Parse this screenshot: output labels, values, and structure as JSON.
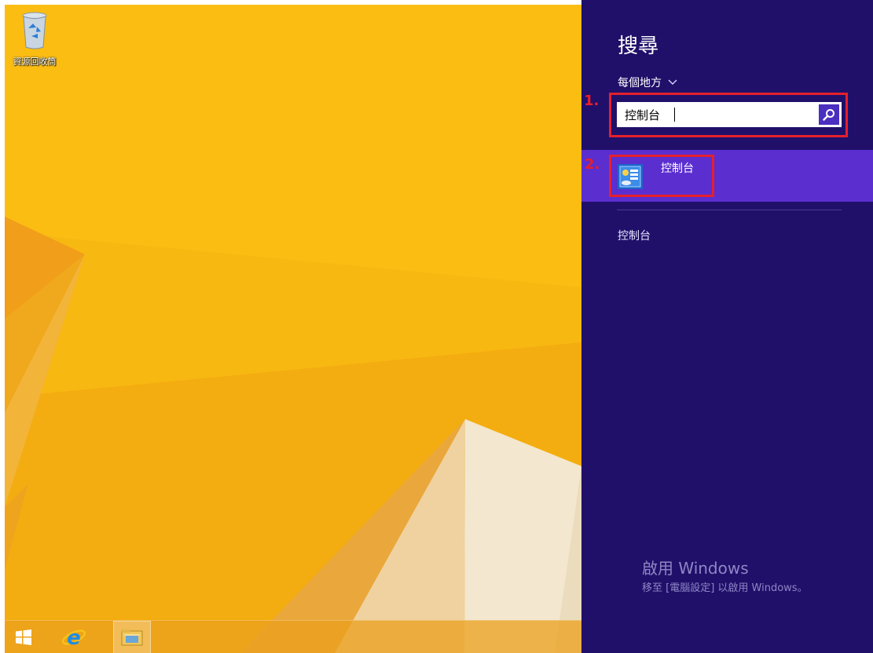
{
  "desktop": {
    "recycle_bin_label": "資源回收筒"
  },
  "taskbar": {
    "items": [
      {
        "icon": "windows-start-icon"
      },
      {
        "icon": "internet-explorer-icon"
      },
      {
        "icon": "file-explorer-icon",
        "active": true
      }
    ]
  },
  "search_charm": {
    "title": "搜尋",
    "scope_label": "每個地方",
    "search_value": "控制台",
    "search_button_icon": "magnifier-icon",
    "result": {
      "label": "控制台",
      "icon": "control-panel-icon"
    },
    "settings_result": "控制台"
  },
  "annotations": {
    "step1": "1.",
    "step2": "2.",
    "color": "#e5202b"
  },
  "watermark": {
    "title": "啟用 Windows",
    "subtitle": "移至 [電腦設定] 以啟用 Windows。"
  },
  "colors": {
    "charm_background": "#20106a",
    "result_highlight": "#5b2ed0",
    "wallpaper_base": "#f8b812"
  }
}
